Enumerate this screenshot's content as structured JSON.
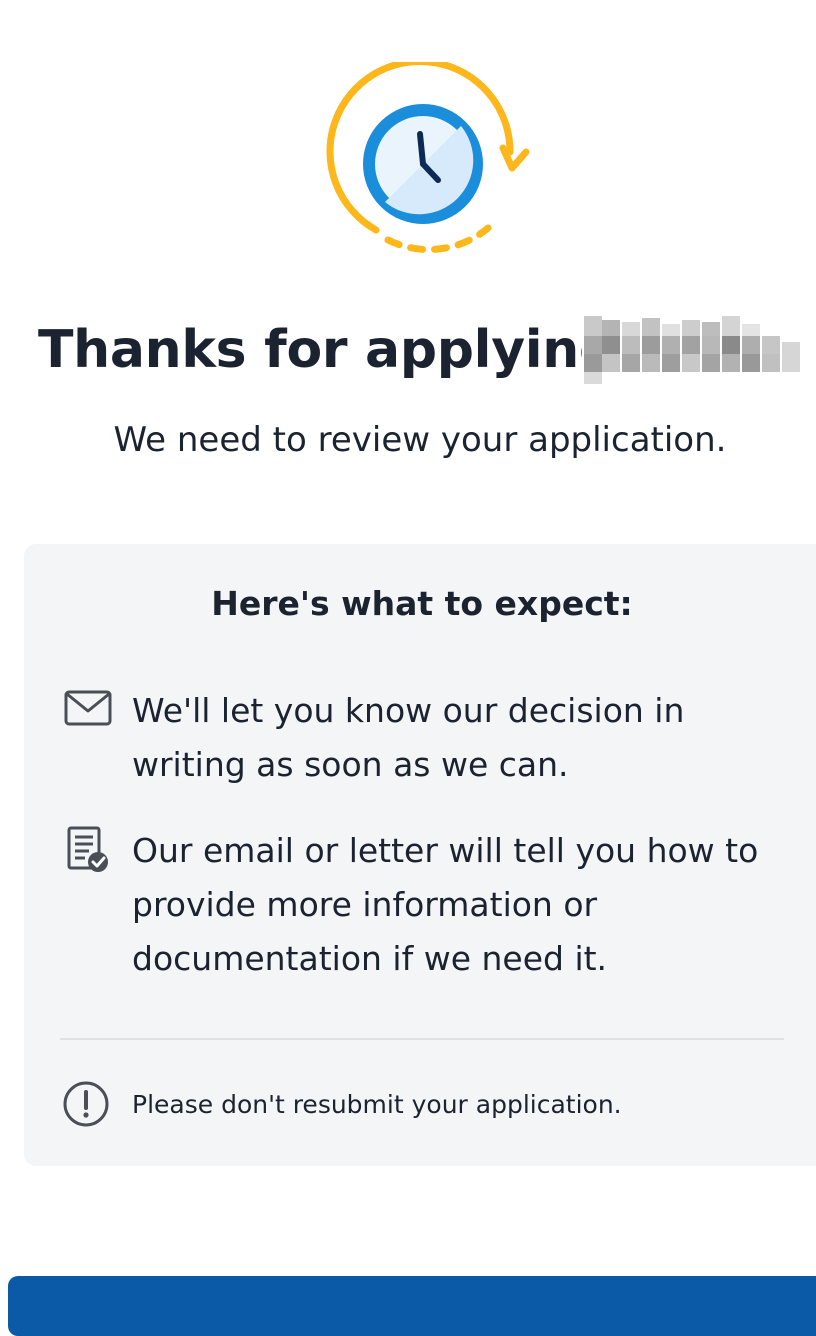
{
  "hero": {
    "icon": "clock-refresh-icon",
    "colors": {
      "ring": "#fdb71a",
      "clock_outer": "#1a8ddb",
      "clock_face": "#e9f4fd",
      "hands": "#0b2a55"
    }
  },
  "headline": {
    "text": "Thanks for applying,",
    "name_redacted": true
  },
  "subhead": "We need to review your application.",
  "expect_card": {
    "heading": "Here's what to expect:",
    "items": [
      {
        "icon": "envelope-icon",
        "text": "We'll let you know our decision in writing as soon as we can."
      },
      {
        "icon": "document-check-icon",
        "text": "Our email or letter will tell you how to provide more information or documentation if we need it."
      }
    ],
    "notice": {
      "icon": "exclamation-circle-icon",
      "text": "Please don't resubmit your application."
    }
  },
  "colors": {
    "text": "#1b2330",
    "card_background": "#f4f5f7",
    "primary_button": "#0a5aa8"
  }
}
